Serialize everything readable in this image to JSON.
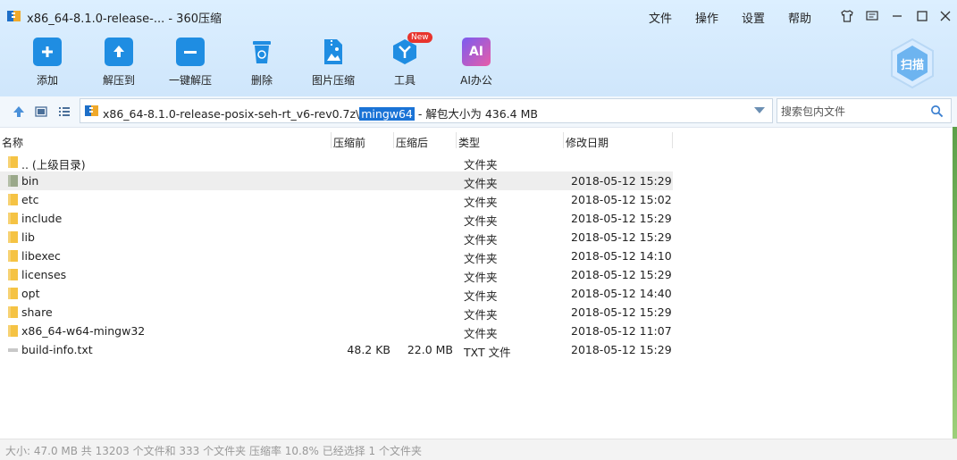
{
  "window": {
    "title": "x86_64-8.1.0-release-... - 360压缩"
  },
  "menu": [
    "文件",
    "操作",
    "设置",
    "帮助"
  ],
  "toolbar": [
    {
      "label": "添加",
      "icon": "add-icon"
    },
    {
      "label": "解压到",
      "icon": "extract-to-icon"
    },
    {
      "label": "一键解压",
      "icon": "one-click-extract-icon"
    },
    {
      "label": "删除",
      "icon": "delete-icon"
    },
    {
      "label": "图片压缩",
      "icon": "image-compress-icon"
    },
    {
      "label": "工具",
      "icon": "tools-icon",
      "badge": "New"
    },
    {
      "label": "AI办公",
      "icon": "ai-office-icon",
      "icon_text": "AI"
    }
  ],
  "scan": {
    "label": "扫描"
  },
  "path": {
    "prefix": "x86_64-8.1.0-release-posix-seh-rt_v6-rev0.7z\\",
    "selected": "mingw64",
    "suffix": " - 解包大小为 436.4 MB"
  },
  "search": {
    "placeholder": "搜索包内文件"
  },
  "columns": {
    "name": "名称",
    "before": "压缩前",
    "after": "压缩后",
    "type": "类型",
    "modified": "修改日期"
  },
  "files": [
    {
      "name": ".. (上级目录)",
      "before": "",
      "after": "",
      "type": "文件夹",
      "date": "",
      "kind": "folder"
    },
    {
      "name": "bin",
      "before": "",
      "after": "",
      "type": "文件夹",
      "date": "2018-05-12 15:29",
      "kind": "folder-selected"
    },
    {
      "name": "etc",
      "before": "",
      "after": "",
      "type": "文件夹",
      "date": "2018-05-12 15:02",
      "kind": "folder"
    },
    {
      "name": "include",
      "before": "",
      "after": "",
      "type": "文件夹",
      "date": "2018-05-12 15:29",
      "kind": "folder"
    },
    {
      "name": "lib",
      "before": "",
      "after": "",
      "type": "文件夹",
      "date": "2018-05-12 15:29",
      "kind": "folder"
    },
    {
      "name": "libexec",
      "before": "",
      "after": "",
      "type": "文件夹",
      "date": "2018-05-12 14:10",
      "kind": "folder"
    },
    {
      "name": "licenses",
      "before": "",
      "after": "",
      "type": "文件夹",
      "date": "2018-05-12 15:29",
      "kind": "folder"
    },
    {
      "name": "opt",
      "before": "",
      "after": "",
      "type": "文件夹",
      "date": "2018-05-12 14:40",
      "kind": "folder"
    },
    {
      "name": "share",
      "before": "",
      "after": "",
      "type": "文件夹",
      "date": "2018-05-12 15:29",
      "kind": "folder"
    },
    {
      "name": "x86_64-w64-mingw32",
      "before": "",
      "after": "",
      "type": "文件夹",
      "date": "2018-05-12 11:07",
      "kind": "folder"
    },
    {
      "name": "build-info.txt",
      "before": "48.2 KB",
      "after": "22.0 MB",
      "type": "TXT 文件",
      "date": "2018-05-12 15:29",
      "kind": "file"
    }
  ],
  "status": {
    "text": "大小: 47.0 MB 共 13203 个文件和 333 个文件夹 压缩率 10.8% 已经选择 1 个文件夹"
  },
  "colors": {
    "accent": "#1a73d6",
    "toolbar_bg": "#d6eafc",
    "folder": "#f5c344",
    "folder_selected": "#9aa88a"
  }
}
